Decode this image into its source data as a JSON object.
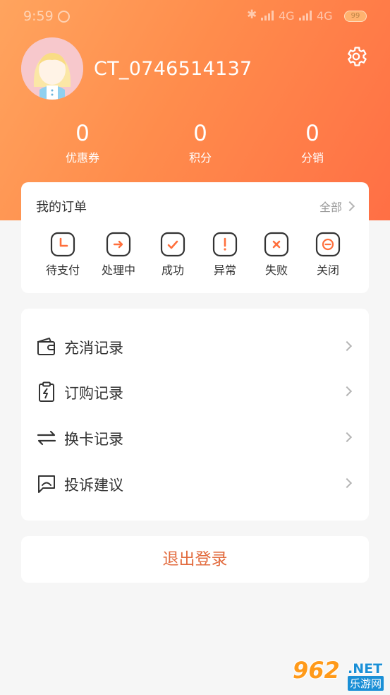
{
  "status_bar": {
    "time": "9:59",
    "network_1": "4G",
    "network_2": "4G",
    "battery": "99"
  },
  "profile": {
    "username": "CT_0746514137"
  },
  "stats": [
    {
      "value": "0",
      "label": "优惠券"
    },
    {
      "value": "0",
      "label": "积分"
    },
    {
      "value": "0",
      "label": "分销"
    }
  ],
  "orders": {
    "title": "我的订单",
    "all_label": "全部",
    "items": [
      {
        "label": "待支付",
        "icon": "clock-icon"
      },
      {
        "label": "处理中",
        "icon": "arrow-right-icon"
      },
      {
        "label": "成功",
        "icon": "check-icon"
      },
      {
        "label": "异常",
        "icon": "exclamation-icon"
      },
      {
        "label": "失败",
        "icon": "x-icon"
      },
      {
        "label": "关闭",
        "icon": "minus-circle-icon"
      }
    ]
  },
  "menu": {
    "items": [
      {
        "label": "充消记录",
        "icon": "wallet-icon"
      },
      {
        "label": "订购记录",
        "icon": "clipboard-icon"
      },
      {
        "label": "换卡记录",
        "icon": "swap-icon"
      },
      {
        "label": "投诉建议",
        "icon": "message-icon"
      }
    ]
  },
  "logout_label": "退出登录",
  "watermark": {
    "number": "962",
    "net": ".NET",
    "site": "乐游网"
  },
  "colors": {
    "header_gradient_start": "#ffa45e",
    "header_gradient_end": "#ff6f45",
    "logout_text": "#e26b3e",
    "background": "#f6f6f6"
  }
}
